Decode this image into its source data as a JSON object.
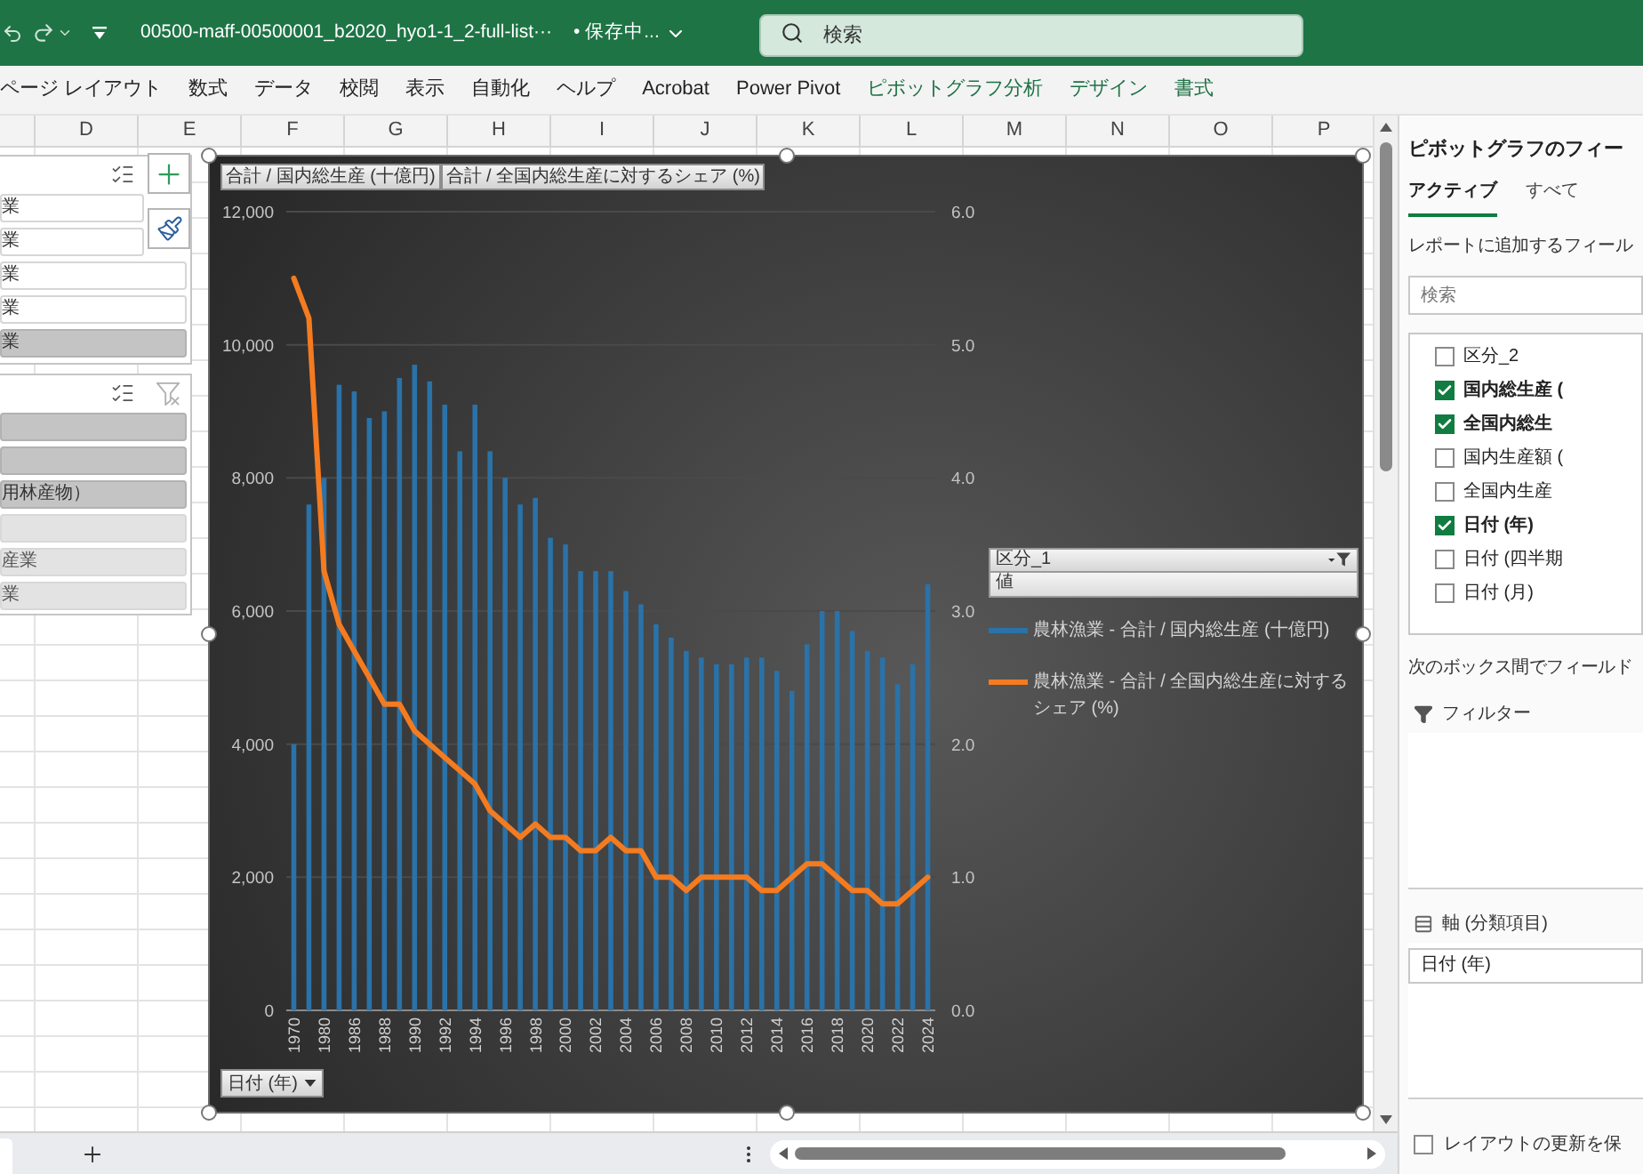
{
  "title_bar": {
    "file_name": "00500-maff-00500001_b2020_hyo1-1_2-full-list···",
    "save_status": "• 保存中...",
    "search": {
      "placeholder": "検索"
    }
  },
  "ribbon_tabs": [
    {
      "label": "ページ レイアウト",
      "kind": "standard"
    },
    {
      "label": "数式",
      "kind": "standard"
    },
    {
      "label": "データ",
      "kind": "standard"
    },
    {
      "label": "校閲",
      "kind": "standard"
    },
    {
      "label": "表示",
      "kind": "standard"
    },
    {
      "label": "自動化",
      "kind": "standard"
    },
    {
      "label": "ヘルプ",
      "kind": "standard"
    },
    {
      "label": "Acrobat",
      "kind": "standard"
    },
    {
      "label": "Power Pivot",
      "kind": "standard"
    },
    {
      "label": "ピボットグラフ分析",
      "kind": "contextual"
    },
    {
      "label": "デザイン",
      "kind": "contextual"
    },
    {
      "label": "書式",
      "kind": "contextual"
    }
  ],
  "column_headers": [
    "D",
    "E",
    "F",
    "G",
    "H",
    "I",
    "J",
    "K",
    "L",
    "M",
    "N",
    "O",
    "P"
  ],
  "slicers": [
    {
      "items": [
        {
          "label": "業",
          "selected": false
        },
        {
          "label": "業",
          "selected": false
        },
        {
          "label": "業",
          "selected": false
        },
        {
          "label": "業",
          "selected": false
        },
        {
          "label": "業",
          "selected": true
        }
      ]
    },
    {
      "items": [
        {
          "selected": true,
          "disabled": false
        },
        {
          "selected": true,
          "disabled": false
        },
        {
          "label": "用林産物）",
          "selected": true,
          "disabled": false
        },
        {
          "selected": false,
          "disabled": true
        },
        {
          "label": "産業",
          "selected": false,
          "disabled": true
        },
        {
          "label": "業",
          "selected": false,
          "disabled": true
        }
      ]
    }
  ],
  "chart": {
    "value_field_buttons": [
      "合計 / 国内総生産 (十億円)",
      "合計 / 全国内総生産に対するシェア (%)"
    ],
    "legend": {
      "field": "区分_1",
      "values_label": "値"
    },
    "axis_field_button": "日付 (年)",
    "chart_data": {
      "type": "bar",
      "grid": true,
      "categories": [
        "1970",
        null,
        "1980",
        null,
        "1986",
        null,
        "1988",
        null,
        "1990",
        null,
        "1992",
        null,
        "1994",
        null,
        "1996",
        null,
        "1998",
        null,
        "2000",
        null,
        "2002",
        null,
        "2004",
        null,
        "2006",
        null,
        "2008",
        null,
        "2010",
        null,
        "2012",
        null,
        "2014",
        null,
        "2016",
        null,
        "2018",
        null,
        "2020",
        null,
        "2022",
        null,
        "2024"
      ],
      "series": [
        {
          "name": "農林漁業 - 合計 / 国内総生産 (十億円)",
          "color": "#2a72a8",
          "values": [
            4000,
            7600,
            8000,
            9400,
            9300,
            8900,
            9000,
            9500,
            9700,
            9450,
            9100,
            8400,
            9100,
            8400,
            8000,
            7600,
            7700,
            7100,
            7000,
            6600,
            6600,
            6600,
            6300,
            6100,
            5800,
            5600,
            5400,
            5300,
            5200,
            5200,
            5300,
            5300,
            5100,
            4800,
            5500,
            6000,
            6000,
            5700,
            5400,
            5300,
            4900,
            5200,
            6400
          ]
        },
        {
          "name": "農林漁業 - 合計 / 全国内総生産に対するシェア (%)",
          "color": "#f47b20",
          "type": "line",
          "axis": "y2",
          "values": [
            5.5,
            5.2,
            3.3,
            2.9,
            2.7,
            2.5,
            2.3,
            2.3,
            2.1,
            2.0,
            1.9,
            1.8,
            1.7,
            1.5,
            1.4,
            1.3,
            1.4,
            1.3,
            1.3,
            1.2,
            1.2,
            1.3,
            1.2,
            1.2,
            1.0,
            1.0,
            0.9,
            1.0,
            1.0,
            1.0,
            1.0,
            0.9,
            0.9,
            1.0,
            1.1,
            1.1,
            1.0,
            0.9,
            0.9,
            0.8,
            0.8,
            0.9,
            1.0
          ]
        }
      ],
      "ylim": [
        0,
        12000
      ],
      "yticks": [
        {
          "value": 0,
          "label": "0"
        },
        {
          "value": 2000,
          "label": "2,000"
        },
        {
          "value": 4000,
          "label": "4,000"
        },
        {
          "value": 6000,
          "label": "6,000"
        },
        {
          "value": 8000,
          "label": "8,000"
        },
        {
          "value": 10000,
          "label": "10,000"
        },
        {
          "value": 12000,
          "label": "12,000"
        }
      ],
      "y2lim": [
        0,
        6
      ],
      "y2ticks": [
        {
          "value": 0,
          "label": "0.0"
        },
        {
          "value": 1,
          "label": "1.0"
        },
        {
          "value": 2,
          "label": "2.0"
        },
        {
          "value": 3,
          "label": "3.0"
        },
        {
          "value": 4,
          "label": "4.0"
        },
        {
          "value": 5,
          "label": "5.0"
        },
        {
          "value": 6,
          "label": "6.0"
        }
      ]
    }
  },
  "field_pane": {
    "title": "ピボットグラフのフィー",
    "tabs": [
      {
        "label": "アクティブ",
        "selected": true
      },
      {
        "label": "すべて",
        "selected": false
      }
    ],
    "instruction": "レポートに追加するフィール",
    "search": {
      "placeholder": "検索"
    },
    "fields": [
      {
        "label": "区分_2",
        "checked": false
      },
      {
        "label": "国内総生産 (",
        "checked": true
      },
      {
        "label": "全国内総生",
        "checked": true
      },
      {
        "label": "国内生産額 (",
        "checked": false
      },
      {
        "label": "全国内生産",
        "checked": false
      },
      {
        "label": "日付 (年)",
        "checked": true
      },
      {
        "label": "日付 (四半期",
        "checked": false
      },
      {
        "label": "日付 (月)",
        "checked": false
      }
    ],
    "areas_hint": "次のボックス間でフィールド",
    "areas": [
      {
        "kind": "filter",
        "label": "フィルター"
      },
      {
        "kind": "axis",
        "label": "軸 (分類項目)",
        "items": [
          "日付 (年)"
        ]
      }
    ],
    "defer_update": {
      "label": "レイアウトの更新を保",
      "checked": false
    }
  }
}
